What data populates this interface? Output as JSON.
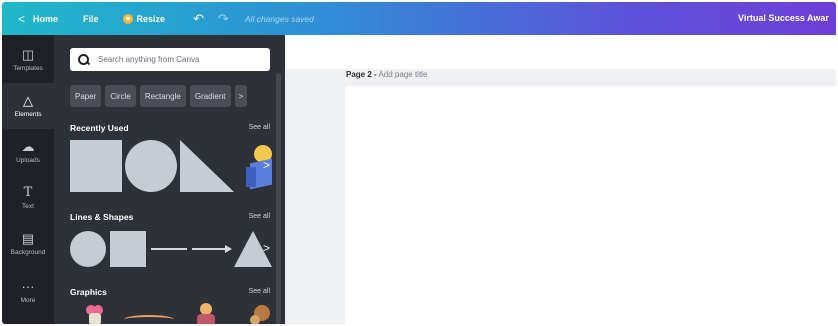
{
  "topbar": {
    "home_label": "Home",
    "file_label": "File",
    "resize_label": "Resize",
    "undo_icon": "↶",
    "redo_icon": "↷",
    "saved_status": "All changes saved",
    "design_title": "Virtual Success Awar"
  },
  "rail": {
    "items": [
      {
        "label": "Templates",
        "icon": "template-icon"
      },
      {
        "label": "Elements",
        "icon": "elements-icon"
      },
      {
        "label": "Uploads",
        "icon": "upload-icon"
      },
      {
        "label": "Text",
        "icon": "text-icon"
      },
      {
        "label": "Background",
        "icon": "background-icon"
      },
      {
        "label": "More",
        "icon": "more-icon"
      }
    ]
  },
  "panel": {
    "search_placeholder": "Search anything from Canva",
    "chips": [
      "Paper",
      "Circle",
      "Rectangle",
      "Gradient"
    ],
    "sections": {
      "recent": {
        "title": "Recently Used",
        "see_all": "See all"
      },
      "lines": {
        "title": "Lines & Shapes",
        "see_all": "See all"
      },
      "graphics": {
        "title": "Graphics",
        "see_all": "See all"
      }
    }
  },
  "canvas": {
    "page_number": "Page 2 -",
    "page_title_hint": "Add page title"
  },
  "colors": {
    "topbar_gradient_start": "#1fb8c9",
    "topbar_gradient_end": "#6d3fd8",
    "rail_bg": "#1f2126",
    "panel_bg": "#2e3138",
    "shape_fill": "#c5ccd6"
  }
}
